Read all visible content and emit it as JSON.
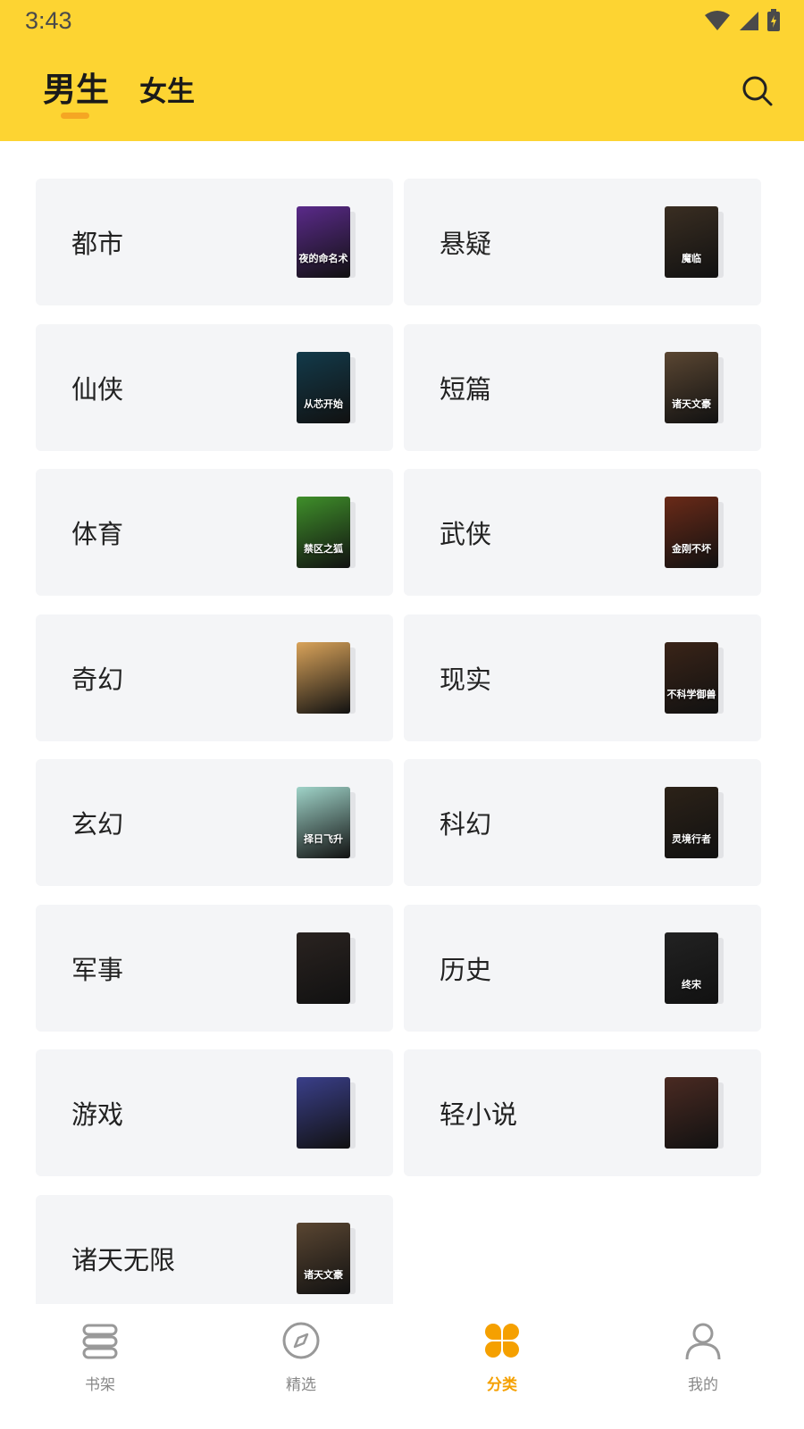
{
  "status_bar": {
    "time": "3:43"
  },
  "header": {
    "tabs": [
      {
        "label": "男生",
        "active": true
      },
      {
        "label": "女生",
        "active": false
      }
    ]
  },
  "categories": [
    {
      "label": "都市",
      "cover_title": "夜的命名术",
      "cover_color": "#5a2a8a"
    },
    {
      "label": "悬疑",
      "cover_title": "魔临",
      "cover_color": "#3a2e22"
    },
    {
      "label": "仙侠",
      "cover_title": "从芯开始",
      "cover_color": "#123a4a"
    },
    {
      "label": "短篇",
      "cover_title": "诸天文豪",
      "cover_color": "#5a4632"
    },
    {
      "label": "体育",
      "cover_title": "禁区之狐",
      "cover_color": "#3f8f2a"
    },
    {
      "label": "武侠",
      "cover_title": "金刚不坏",
      "cover_color": "#6a2a18"
    },
    {
      "label": "奇幻",
      "cover_title": "",
      "cover_color": "#d9a35a"
    },
    {
      "label": "现实",
      "cover_title": "不科学御兽",
      "cover_color": "#3a2418"
    },
    {
      "label": "玄幻",
      "cover_title": "择日飞升",
      "cover_color": "#9fd3c8"
    },
    {
      "label": "科幻",
      "cover_title": "灵境行者",
      "cover_color": "#2c2218"
    },
    {
      "label": "军事",
      "cover_title": "",
      "cover_color": "#2a2320"
    },
    {
      "label": "历史",
      "cover_title": "终宋",
      "cover_color": "#222222"
    },
    {
      "label": "游戏",
      "cover_title": "",
      "cover_color": "#3a3f8a"
    },
    {
      "label": "轻小说",
      "cover_title": "",
      "cover_color": "#4a2a22"
    },
    {
      "label": "诸天无限",
      "cover_title": "诸天文豪",
      "cover_color": "#5a4632"
    }
  ],
  "bottom_nav": [
    {
      "label": "书架",
      "icon": "bookshelf-icon",
      "active": false
    },
    {
      "label": "精选",
      "icon": "compass-icon",
      "active": false
    },
    {
      "label": "分类",
      "icon": "category-icon",
      "active": true
    },
    {
      "label": "我的",
      "icon": "profile-icon",
      "active": false
    }
  ],
  "colors": {
    "accent": "#fdd432",
    "active_tab": "#f5a000",
    "indicator": "#f5a623"
  }
}
